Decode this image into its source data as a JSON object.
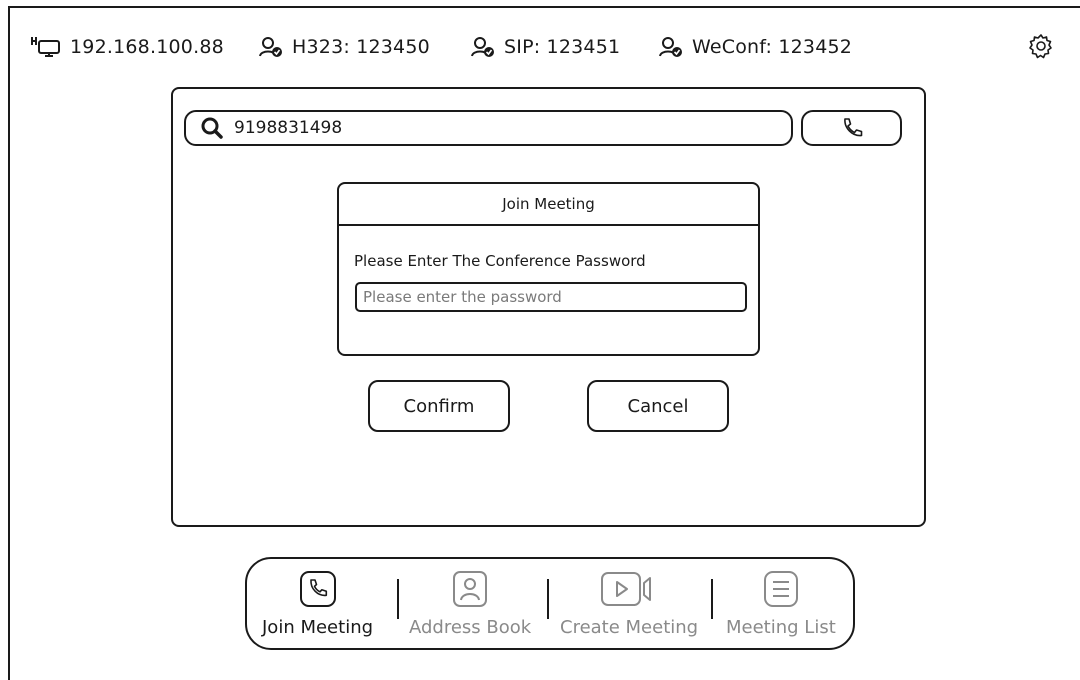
{
  "status_bar": {
    "ip": "192.168.100.88",
    "h323": "H323: 123450",
    "sip": "SIP: 123451",
    "weconf": "WeConf: 123452"
  },
  "search": {
    "value": "9198831498"
  },
  "dialog": {
    "title": "Join Meeting",
    "label": "Please Enter The Conference Password",
    "placeholder": "Please enter the password"
  },
  "buttons": {
    "confirm": "Confirm",
    "cancel": "Cancel"
  },
  "nav": {
    "items": [
      {
        "label": "Join Meeting",
        "icon": "phone-icon",
        "active": true
      },
      {
        "label": "Address Book",
        "icon": "contact-icon",
        "active": false
      },
      {
        "label": "Create Meeting",
        "icon": "video-icon",
        "active": false
      },
      {
        "label": "Meeting List",
        "icon": "list-icon",
        "active": false
      }
    ]
  },
  "colors": {
    "foreground": "#1a1a1a",
    "inactive": "#8a8a8a",
    "background": "#ffffff"
  }
}
